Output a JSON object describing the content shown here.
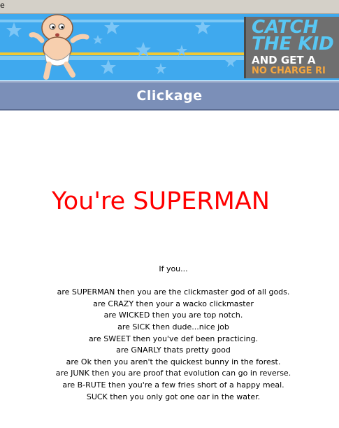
{
  "window": {
    "title_fragment": "e"
  },
  "banner": {
    "ad": {
      "line1": "CATCH",
      "line2": "THE KID",
      "line3": "AND GET A",
      "line4": "NO CHARGE RI"
    }
  },
  "header": {
    "title": "Clickage"
  },
  "result": {
    "heading": "You're SUPERMAN"
  },
  "legend": {
    "intro": "If you...",
    "lines": [
      "are SUPERMAN then you are the clickmaster god of all gods.",
      "are CRAZY then your a wacko clickmaster",
      "are WICKED then you are top notch.",
      "are SICK then dude...nice job",
      "are SWEET then you've def been practicing.",
      "are GNARLY thats pretty good",
      "are Ok then you aren't the quickest bunny in the forest.",
      "are JUNK then you are proof that evolution can go in reverse.",
      "are B-RUTE then you're a few fries short of a happy meal.",
      "SUCK then you only got one oar in the water."
    ]
  },
  "colors": {
    "banner_sky": "#3fa9ee",
    "banner_stripe": "#f2c832",
    "ad_panel": "#6f6f6f",
    "ad_headline": "#58c7f4",
    "ad_offer": "#f4a640",
    "header_bar": "#7b8fb8",
    "result_red": "#ff0000"
  },
  "icons": [
    "baby-mascot-illustration",
    "star-icon"
  ]
}
